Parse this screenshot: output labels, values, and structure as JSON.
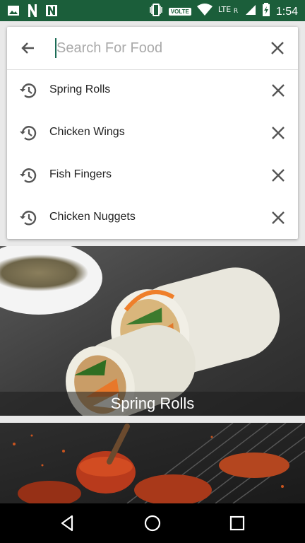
{
  "status_bar": {
    "time": "1:54",
    "volte": "VOLTE",
    "network": "LTE",
    "roaming": "R",
    "icons": [
      "image-icon",
      "n-icon",
      "n-icon",
      "vibrate-icon",
      "wifi-icon",
      "signal-icon",
      "signal-icon",
      "battery-icon"
    ]
  },
  "search": {
    "placeholder": "Search For Food",
    "value": ""
  },
  "history": [
    {
      "label": "Spring Rolls"
    },
    {
      "label": "Chicken Wings"
    },
    {
      "label": "Fish Fingers"
    },
    {
      "label": "Chicken Nuggets"
    }
  ],
  "cards": [
    {
      "caption": "Spring Rolls"
    },
    {
      "caption": ""
    }
  ],
  "colors": {
    "status_bar": "#1b5e3a",
    "caret": "#1b6b55"
  }
}
